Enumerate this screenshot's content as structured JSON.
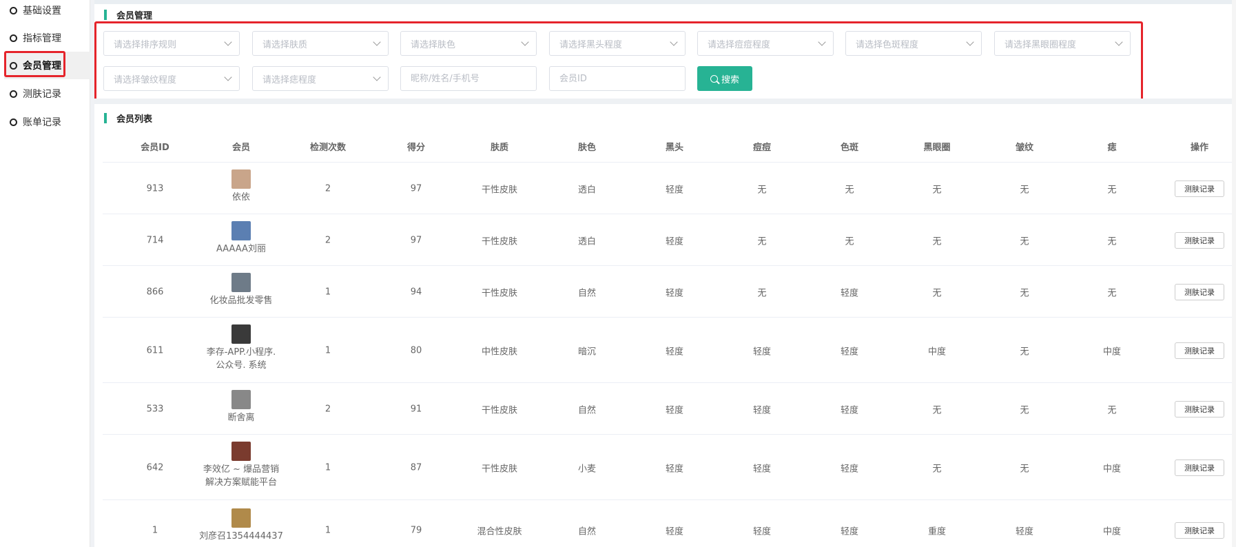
{
  "sidebar": {
    "items": [
      {
        "label": "基础设置"
      },
      {
        "label": "指标管理"
      },
      {
        "label": "会员管理"
      },
      {
        "label": "测肤记录"
      },
      {
        "label": "账单记录"
      }
    ]
  },
  "filters": {
    "title": "会员管理",
    "selects": [
      {
        "placeholder": "请选择排序规则"
      },
      {
        "placeholder": "请选择肤质"
      },
      {
        "placeholder": "请选择肤色"
      },
      {
        "placeholder": "请选择黑头程度"
      },
      {
        "placeholder": "请选择痘痘程度"
      },
      {
        "placeholder": "请选择色斑程度"
      },
      {
        "placeholder": "请选择黑眼圈程度"
      },
      {
        "placeholder": "请选择皱纹程度"
      },
      {
        "placeholder": "请选择痣程度"
      }
    ],
    "name_placeholder": "昵称/姓名/手机号",
    "id_placeholder": "会员ID",
    "search_label": "搜索"
  },
  "list": {
    "title": "会员列表",
    "columns": [
      "会员ID",
      "会员",
      "检测次数",
      "得分",
      "肤质",
      "肤色",
      "黑头",
      "痘痘",
      "色斑",
      "黑眼圈",
      "皱纹",
      "痣",
      "操作"
    ],
    "op_label": "测肤记录",
    "rows": [
      {
        "id": "913",
        "name": "依依",
        "count": "2",
        "score": "97",
        "skin_type": "干性皮肤",
        "skin_color": "透白",
        "blackhead": "轻度",
        "acne": "无",
        "spot": "无",
        "dark_circle": "无",
        "wrinkle": "无",
        "mole": "无",
        "avatar_color": "#c9a58a"
      },
      {
        "id": "714",
        "name": "AAAAA刘丽",
        "count": "2",
        "score": "97",
        "skin_type": "干性皮肤",
        "skin_color": "透白",
        "blackhead": "轻度",
        "acne": "无",
        "spot": "无",
        "dark_circle": "无",
        "wrinkle": "无",
        "mole": "无",
        "avatar_color": "#5b7fb2"
      },
      {
        "id": "866",
        "name": "化妆品批发零售",
        "count": "1",
        "score": "94",
        "skin_type": "干性皮肤",
        "skin_color": "自然",
        "blackhead": "轻度",
        "acne": "无",
        "spot": "轻度",
        "dark_circle": "无",
        "wrinkle": "无",
        "mole": "无",
        "avatar_color": "#6e7b88"
      },
      {
        "id": "611",
        "name": "李存-APP.小程序.\n公众号. 系统",
        "count": "1",
        "score": "80",
        "skin_type": "中性皮肤",
        "skin_color": "暗沉",
        "blackhead": "轻度",
        "acne": "轻度",
        "spot": "轻度",
        "dark_circle": "中度",
        "wrinkle": "无",
        "mole": "中度",
        "avatar_color": "#3a3a3a"
      },
      {
        "id": "533",
        "name": "断舍离",
        "count": "2",
        "score": "91",
        "skin_type": "干性皮肤",
        "skin_color": "自然",
        "blackhead": "轻度",
        "acne": "轻度",
        "spot": "轻度",
        "dark_circle": "无",
        "wrinkle": "无",
        "mole": "无",
        "avatar_color": "#888888"
      },
      {
        "id": "642",
        "name": "李效亿 ~ 爆品营销\n解决方案赋能平台",
        "count": "1",
        "score": "87",
        "skin_type": "干性皮肤",
        "skin_color": "小麦",
        "blackhead": "轻度",
        "acne": "轻度",
        "spot": "轻度",
        "dark_circle": "无",
        "wrinkle": "无",
        "mole": "中度",
        "avatar_color": "#7a3b2e"
      },
      {
        "id": "1",
        "name": "刘彦召1354444437",
        "count": "1",
        "score": "79",
        "skin_type": "混合性皮肤",
        "skin_color": "自然",
        "blackhead": "轻度",
        "acne": "轻度",
        "spot": "轻度",
        "dark_circle": "重度",
        "wrinkle": "轻度",
        "mole": "中度",
        "avatar_color": "#b08a4a"
      }
    ]
  }
}
